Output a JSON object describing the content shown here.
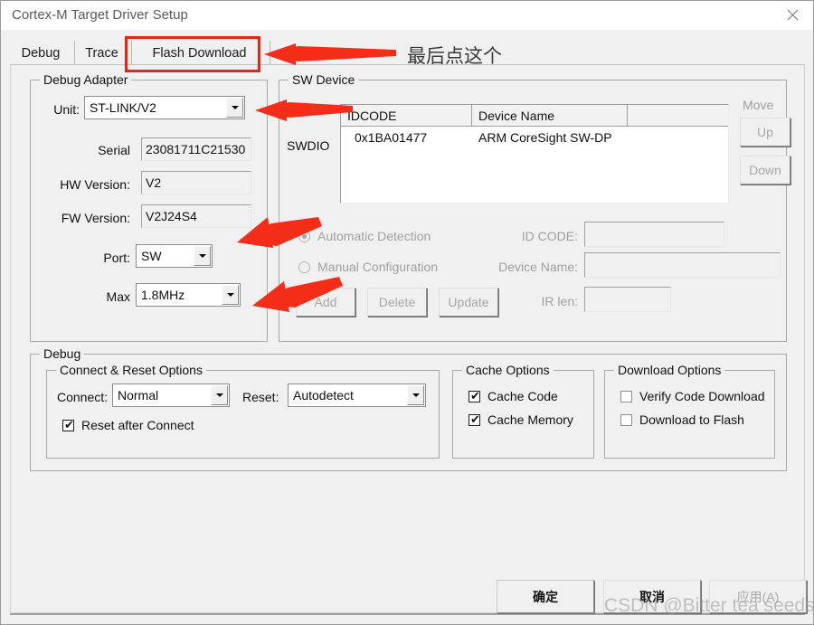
{
  "window": {
    "title": "Cortex-M Target Driver Setup",
    "close_icon": "close-icon"
  },
  "tabs": [
    {
      "label": "Debug",
      "active": true
    },
    {
      "label": "Trace",
      "active": false
    },
    {
      "label": "Flash Download",
      "active": false
    }
  ],
  "debug_adapter": {
    "title": "Debug Adapter",
    "unit_label": "Unit:",
    "unit_value": "ST-LINK/V2",
    "serial_label": "Serial",
    "serial_value": "23081711C21530",
    "hw_version_label": "HW Version:",
    "hw_version_value": "V2",
    "fw_version_label": "FW Version:",
    "fw_version_value": "V2J24S4",
    "port_label": "Port:",
    "port_value": "SW",
    "max_label": "Max",
    "max_value": "1.8MHz"
  },
  "sw_device": {
    "title": "SW Device",
    "swdio_label": "SWDIO",
    "columns": [
      "IDCODE",
      "Device Name",
      ""
    ],
    "rows": [
      {
        "idcode": "0x1BA01477",
        "device_name": "ARM CoreSight SW-DP",
        "extra": ""
      }
    ],
    "move_label": "Move",
    "up_label": "Up",
    "down_label": "Down",
    "automatic_detection_label": "Automatic Detection",
    "manual_configuration_label": "Manual Configuration",
    "id_code_label": "ID CODE:",
    "id_code_value": "",
    "device_name_label": "Device Name:",
    "device_name_value": "",
    "ir_len_label": "IR len:",
    "ir_len_value": "",
    "add_label": "Add",
    "delete_label": "Delete",
    "update_label": "Update"
  },
  "debug_section": {
    "title": "Debug",
    "connect_reset": {
      "title": "Connect & Reset Options",
      "connect_label": "Connect:",
      "connect_value": "Normal",
      "reset_label": "Reset:",
      "reset_value": "Autodetect",
      "reset_after_connect_label": "Reset after Connect",
      "reset_after_connect_checked": true
    },
    "cache_options": {
      "title": "Cache Options",
      "cache_code_label": "Cache Code",
      "cache_code_checked": true,
      "cache_memory_label": "Cache Memory",
      "cache_memory_checked": true
    },
    "download_options": {
      "title": "Download Options",
      "verify_code_download_label": "Verify Code Download",
      "verify_code_download_checked": false,
      "download_to_flash_label": "Download to Flash",
      "download_to_flash_checked": false
    }
  },
  "footer": {
    "ok_label": "确定",
    "cancel_label": "取消",
    "apply_label": "应用(A)"
  },
  "annotations": {
    "note_click_last": "最后点这个",
    "highlight_color": "#ee2211",
    "watermark": "CSDN @Bitter tea seeds"
  }
}
